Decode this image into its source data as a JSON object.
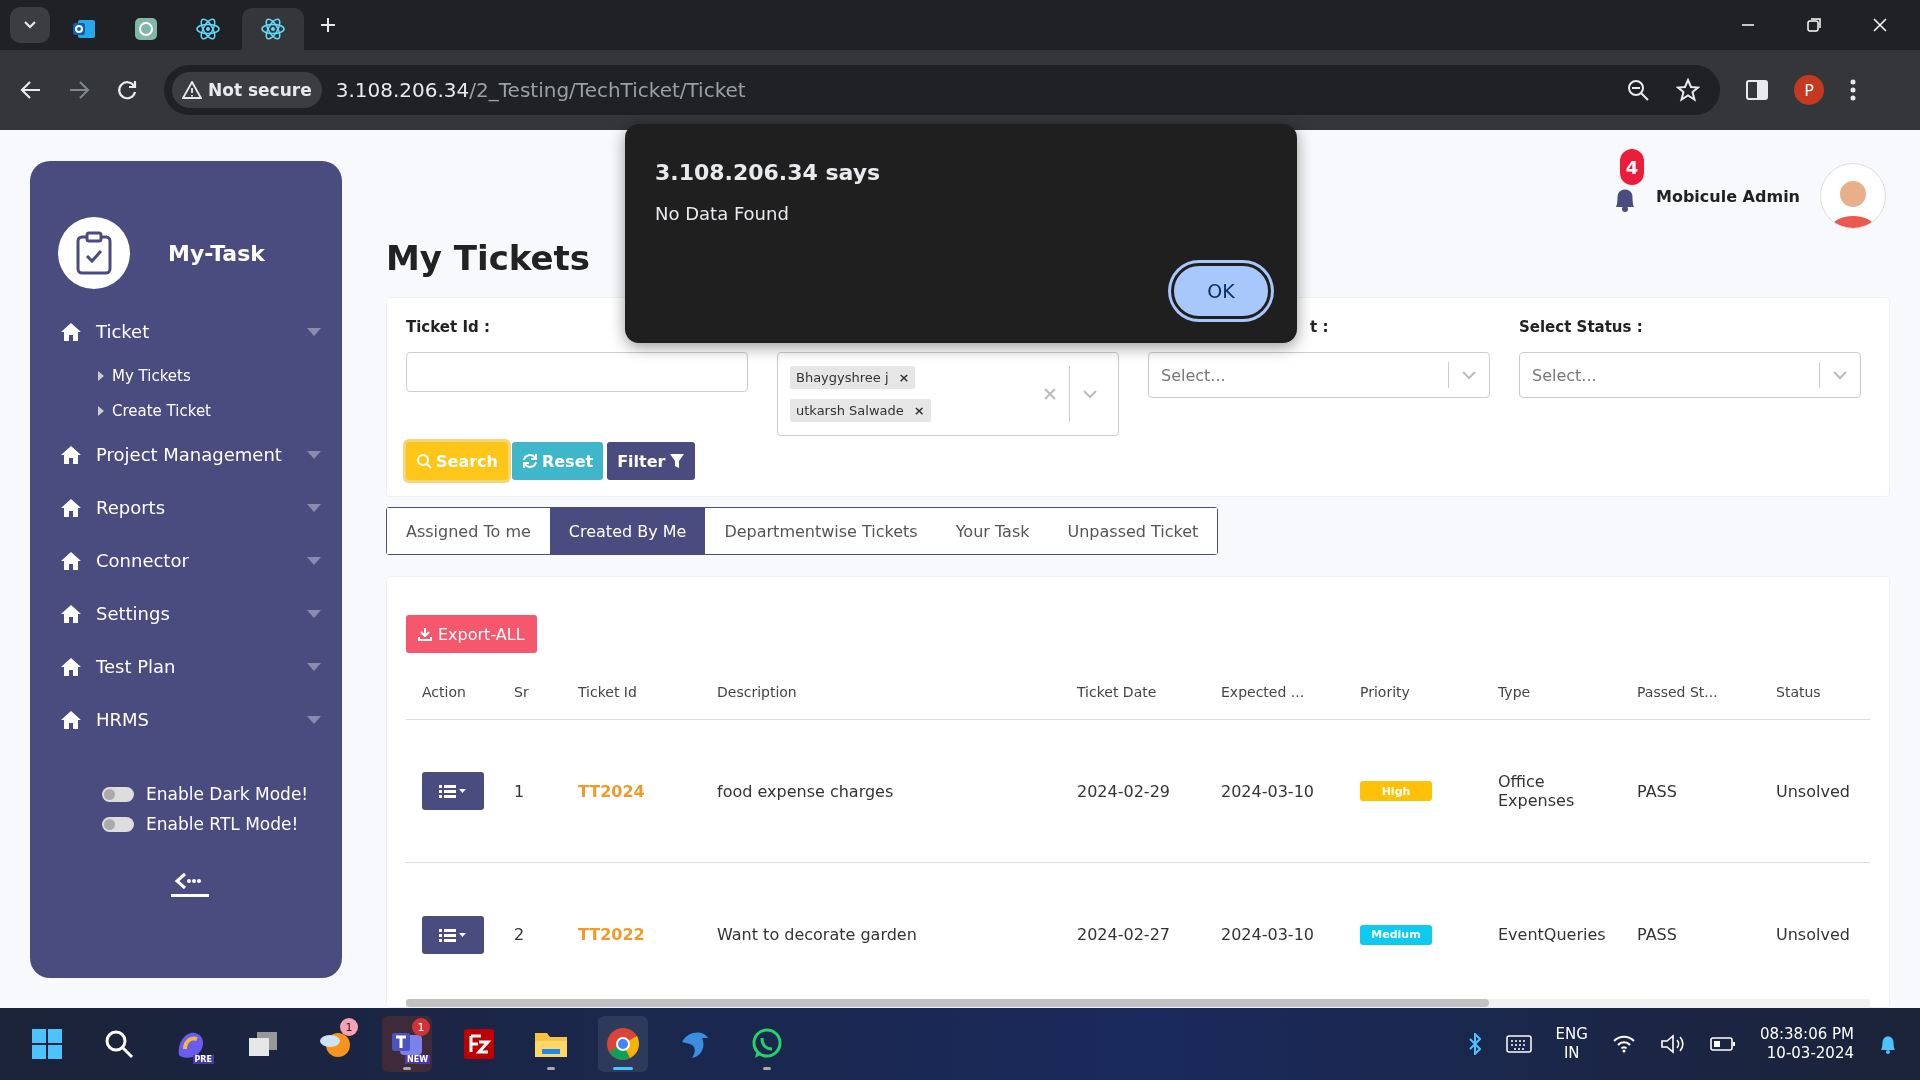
{
  "browser": {
    "tabs": [
      {
        "kind": "mail",
        "selected": false
      },
      {
        "kind": "chat",
        "selected": false
      },
      {
        "kind": "atom",
        "selected": false
      },
      {
        "kind": "atom",
        "selected": true
      }
    ],
    "security_label": "Not secure",
    "url_host": "3.108.206.34",
    "url_path": "/2_Testing/TechTicket/Ticket",
    "profile_initial": "P"
  },
  "sidebar": {
    "brand": "My-Task",
    "items": [
      {
        "label": "Ticket",
        "children": [
          {
            "label": "My Tickets"
          },
          {
            "label": "Create Ticket"
          }
        ]
      },
      {
        "label": "Project Management"
      },
      {
        "label": "Reports"
      },
      {
        "label": "Connector"
      },
      {
        "label": "Settings"
      },
      {
        "label": "Test Plan"
      },
      {
        "label": "HRMS"
      }
    ],
    "toggles": [
      {
        "label": "Enable Dark Mode!",
        "on": false
      },
      {
        "label": "Enable RTL Mode!",
        "on": false
      }
    ]
  },
  "header": {
    "notification_count": "4",
    "user_name": "Mobicule Admin"
  },
  "page_title": "My Tickets",
  "filters": {
    "ticket_id": {
      "label": "Ticket Id :"
    },
    "assignees": {
      "chips": [
        {
          "label": "Bhaygyshree j",
          "remove": "×"
        },
        {
          "label": "utkarsh Salwade",
          "remove": "×"
        }
      ]
    },
    "select_3": {
      "label": "t :",
      "placeholder": "Select..."
    },
    "status": {
      "label": "Select Status :",
      "placeholder": "Select..."
    },
    "buttons": [
      {
        "kind": "search",
        "label": "Search"
      },
      {
        "kind": "reset",
        "label": "Reset"
      },
      {
        "kind": "filter",
        "label": "Filter"
      }
    ]
  },
  "tabs": [
    {
      "label": "Assigned To me",
      "selected": false
    },
    {
      "label": "Created By Me",
      "selected": true
    },
    {
      "label": "Departmentwise Tickets",
      "selected": false
    },
    {
      "label": "Your Task",
      "selected": false
    },
    {
      "label": "Unpassed Ticket",
      "selected": false
    }
  ],
  "export_button": "Export-ALL",
  "table": {
    "columns": [
      "Action",
      "Sr",
      "Ticket Id",
      "Description",
      "Ticket Date",
      "Expected ...",
      "Priority",
      "Type",
      "Passed St...",
      "Status"
    ],
    "rows": [
      {
        "sr": "1",
        "ticket_id": "TT2024",
        "description": "food expense charges",
        "ticket_date": "2024-02-29",
        "expected": "2024-03-10",
        "priority": "High",
        "color": "#ffc107",
        "type": "Office Expenses",
        "passed": "PASS",
        "status": "Unsolved"
      },
      {
        "sr": "2",
        "ticket_id": "TT2022",
        "description": "Want to decorate garden",
        "ticket_date": "2024-02-27",
        "expected": "2024-03-10",
        "priority": "Medium",
        "color": "#0dcaf0",
        "type": "EventQueries",
        "passed": "PASS",
        "status": "Unsolved"
      }
    ]
  },
  "dialog": {
    "title": "3.108.206.34 says",
    "message": "No Data Found",
    "button": "OK"
  },
  "taskbar": {
    "apps": [
      {
        "kind": "start",
        "running": false,
        "active": false
      },
      {
        "kind": "search",
        "running": false,
        "active": false
      },
      {
        "kind": "copilot",
        "tag": "PRE",
        "running": false,
        "active": false
      },
      {
        "kind": "taskview",
        "running": false,
        "active": false
      },
      {
        "kind": "weather",
        "badge": "1",
        "running": false,
        "active": false
      },
      {
        "kind": "teams",
        "tag": "NEW",
        "badge": "1",
        "running": true,
        "active": false
      },
      {
        "kind": "ftp",
        "running": false,
        "active": false
      },
      {
        "kind": "folder",
        "running": true,
        "active": false
      },
      {
        "kind": "browser",
        "running": true,
        "active": true
      },
      {
        "kind": "dolphin",
        "running": false,
        "active": false
      },
      {
        "kind": "whatsapp",
        "running": true,
        "active": false
      }
    ],
    "language": "ENG",
    "region": "IN",
    "time": "08:38:06 PM",
    "date": "10-03-2024"
  }
}
